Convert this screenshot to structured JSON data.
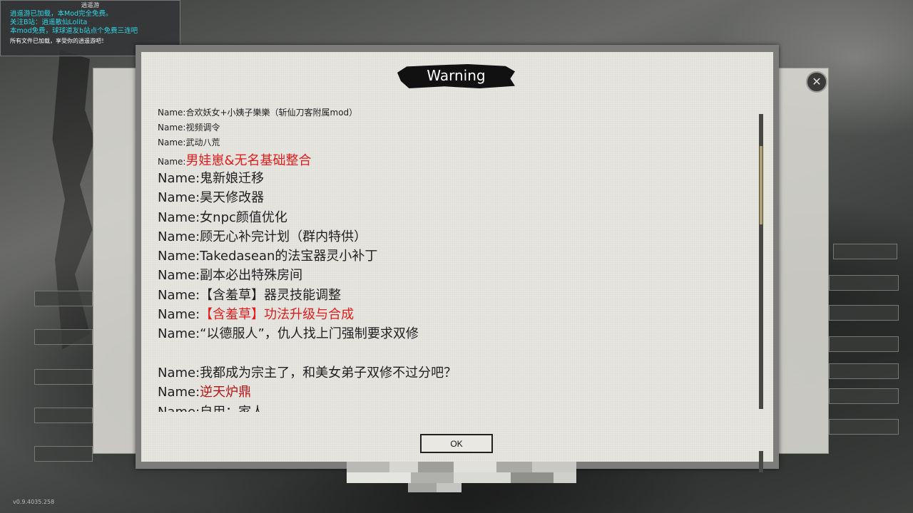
{
  "notice": {
    "title": "逍遥游",
    "lines_cyan": [
      "逍遥游已加载，本Mod完全免费。",
      "关注B站：逍遥散仙Lolita",
      "本mod免费，球球道友b站点个免费三连吧"
    ],
    "line_white": "所有文件已加载，享受你的逍遥游吧！"
  },
  "dialog": {
    "title": "Warning",
    "ok_label": "OK",
    "prefix": "Name:",
    "rows": [
      {
        "size": "small",
        "name": "合欢妖女+小姨子樂樂（斩仙刀客附属mod）",
        "color": "normal"
      },
      {
        "size": "small",
        "name": "视频调令",
        "color": "normal"
      },
      {
        "size": "small",
        "name": "武动八荒",
        "color": "normal"
      },
      {
        "size": "mixed",
        "name": "男娃崽&无名基础整合",
        "color": "red"
      },
      {
        "size": "large",
        "name": "鬼新娘迁移",
        "color": "normal"
      },
      {
        "size": "large",
        "name": "昊天修改器",
        "color": "normal"
      },
      {
        "size": "large",
        "name": "女npc颜值优化",
        "color": "normal"
      },
      {
        "size": "large",
        "name": "顾无心补完计划（群内特供）",
        "color": "normal"
      },
      {
        "size": "large",
        "name": "Takedasean的法宝器灵小补丁",
        "color": "normal"
      },
      {
        "size": "large",
        "name": "副本必出特殊房间",
        "color": "normal"
      },
      {
        "size": "large",
        "name": "【含羞草】器灵技能调整",
        "color": "normal"
      },
      {
        "size": "large",
        "name": "【含羞草】功法升级与合成",
        "color": "red"
      },
      {
        "size": "large",
        "name": "“以德服人”，仇人找上门强制要求双修",
        "color": "normal"
      },
      {
        "size": "blank",
        "name": "",
        "color": "normal"
      },
      {
        "size": "large",
        "name": "我都成为宗主了，和美女弟子双修不过分吧？",
        "color": "normal"
      },
      {
        "size": "large",
        "name": "逆天炉鼎",
        "color": "dark"
      },
      {
        "size": "large",
        "name": "自用：家人",
        "color": "normal"
      }
    ]
  },
  "background": {
    "close_icon": "close-icon",
    "version": "v0.9.4035.258"
  },
  "colors": {
    "red": "#e21c1c",
    "dark_red": "#b51414",
    "cyan": "#2fd8e8"
  }
}
